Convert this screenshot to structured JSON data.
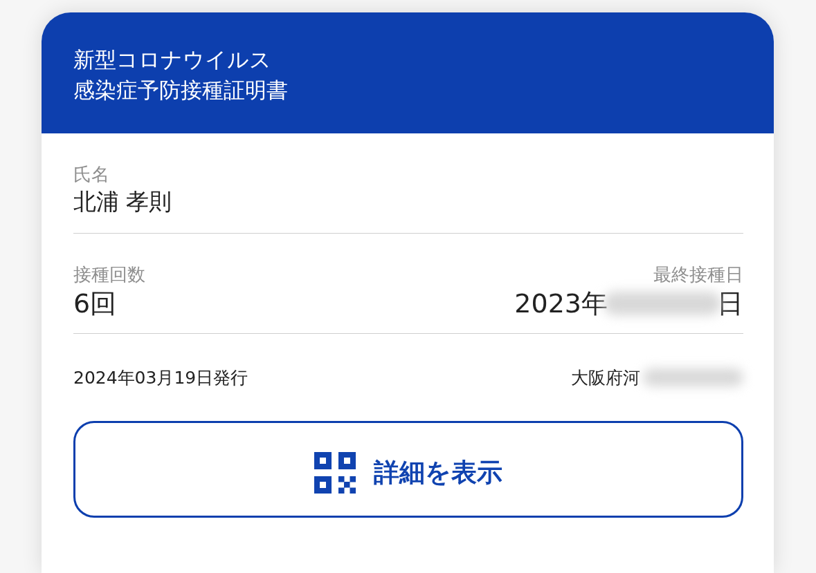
{
  "header": {
    "title_lines": [
      "新型コロナウイルス",
      "感染症予防接種証明書"
    ]
  },
  "name_field": {
    "label": "氏名",
    "value": "北浦 孝則"
  },
  "dose_count": {
    "label": "接種回数",
    "value": "6回"
  },
  "last_dose": {
    "label": "最終接種日",
    "value_start": "2023年",
    "value_end": "日"
  },
  "issue_date": "2024年03月19日発行",
  "issuer_start": "大阪府河",
  "details_button": {
    "label": "詳細を表示"
  }
}
